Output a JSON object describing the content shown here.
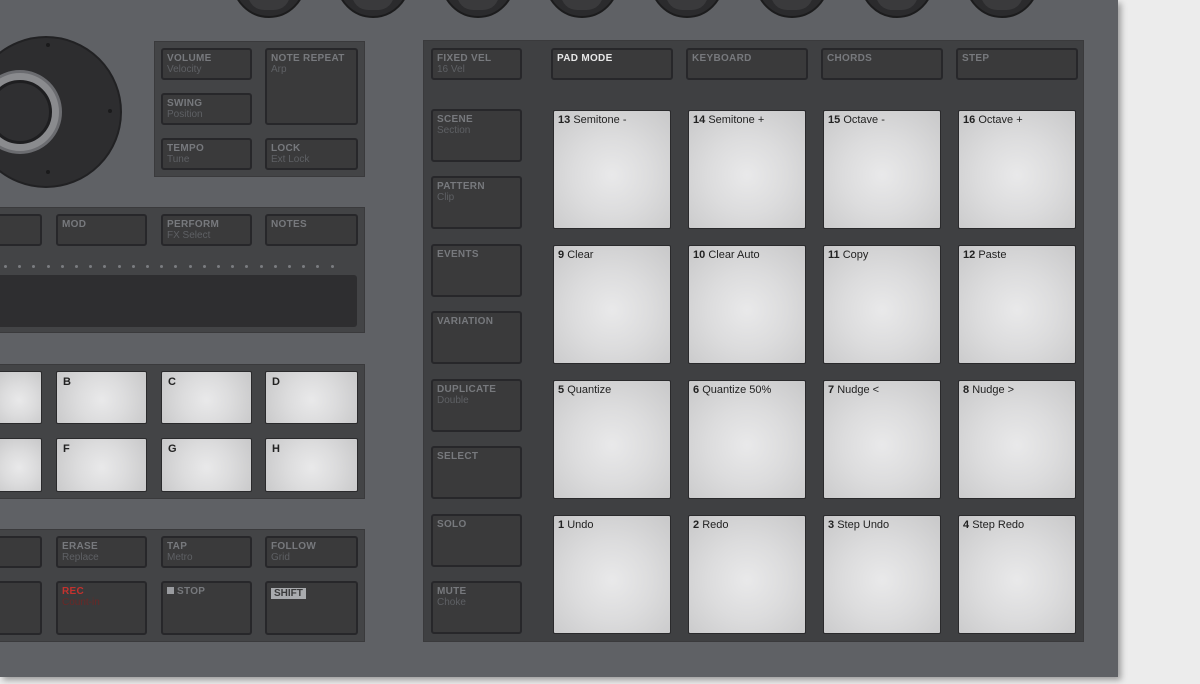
{
  "left_top_panel": {
    "volume": {
      "label": "VOLUME",
      "sub": "Velocity"
    },
    "swing": {
      "label": "SWING",
      "sub": "Position"
    },
    "tempo": {
      "label": "TEMPO",
      "sub": "Tune"
    },
    "note_repeat": {
      "label": "NOTE REPEAT",
      "sub": "Arp"
    },
    "lock": {
      "label": "LOCK",
      "sub": "Ext Lock"
    }
  },
  "mode_row": {
    "mod": {
      "label": "MOD"
    },
    "perform": {
      "label": "PERFORM",
      "sub": "FX Select"
    },
    "notes": {
      "label": "NOTES"
    }
  },
  "group_pads": [
    "B",
    "C",
    "D",
    "F",
    "G",
    "H"
  ],
  "transport": {
    "erase": {
      "label": "ERASE",
      "sub": "Replace"
    },
    "tap": {
      "label": "TAP",
      "sub": "Metro"
    },
    "follow": {
      "label": "FOLLOW",
      "sub": "Grid"
    },
    "rec": {
      "label": "REC",
      "sub": "Count-in"
    },
    "stop": {
      "label": "STOP"
    },
    "shift": {
      "label": "SHIFT"
    }
  },
  "side_buttons": [
    {
      "label": "FIXED VEL",
      "sub": "16 Vel"
    },
    {
      "label": "SCENE",
      "sub": "Section"
    },
    {
      "label": "PATTERN",
      "sub": "Clip"
    },
    {
      "label": "EVENTS",
      "sub": ""
    },
    {
      "label": "VARIATION",
      "sub": ""
    },
    {
      "label": "DUPLICATE",
      "sub": "Double"
    },
    {
      "label": "SELECT",
      "sub": ""
    },
    {
      "label": "SOLO",
      "sub": ""
    },
    {
      "label": "MUTE",
      "sub": "Choke"
    }
  ],
  "pad_mode_row": [
    {
      "label": "PAD MODE",
      "active": true
    },
    {
      "label": "KEYBOARD",
      "active": false
    },
    {
      "label": "CHORDS",
      "active": false
    },
    {
      "label": "STEP",
      "active": false
    }
  ],
  "pads": [
    [
      {
        "num": "13",
        "name": "Semitone -"
      },
      {
        "num": "14",
        "name": "Semitone +"
      },
      {
        "num": "15",
        "name": "Octave -"
      },
      {
        "num": "16",
        "name": "Octave +"
      }
    ],
    [
      {
        "num": "9",
        "name": "Clear"
      },
      {
        "num": "10",
        "name": "Clear Auto"
      },
      {
        "num": "11",
        "name": "Copy"
      },
      {
        "num": "12",
        "name": "Paste"
      }
    ],
    [
      {
        "num": "5",
        "name": "Quantize"
      },
      {
        "num": "6",
        "name": "Quantize 50%"
      },
      {
        "num": "7",
        "name": "Nudge <"
      },
      {
        "num": "8",
        "name": "Nudge >"
      }
    ],
    [
      {
        "num": "1",
        "name": "Undo"
      },
      {
        "num": "2",
        "name": "Redo"
      },
      {
        "num": "3",
        "name": "Step Undo"
      },
      {
        "num": "4",
        "name": "Step Redo"
      }
    ]
  ],
  "icons": {
    "stop": "stop-square-icon",
    "jog": "jog-wheel-icon"
  }
}
